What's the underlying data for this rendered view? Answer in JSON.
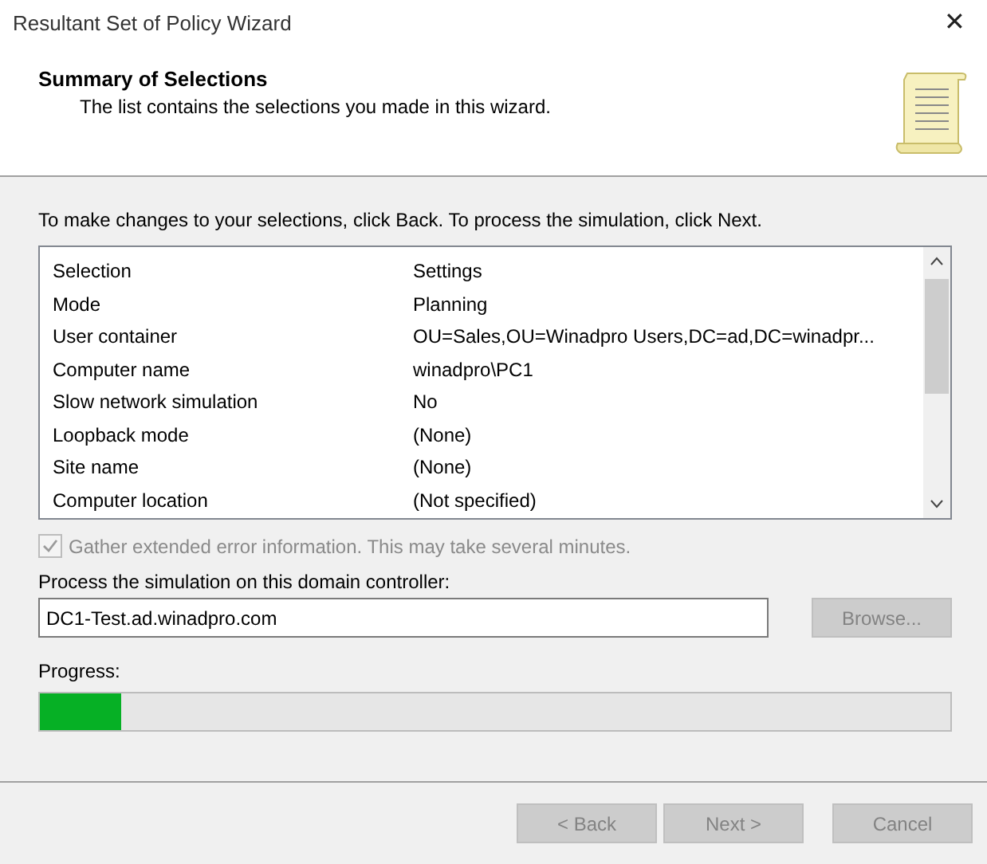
{
  "window": {
    "title": "Resultant Set of Policy Wizard",
    "close": "✕"
  },
  "header": {
    "title": "Summary of Selections",
    "subtitle": "The list contains the selections you made in this wizard."
  },
  "instruction": "To make changes to your selections, click Back. To process the simulation, click Next.",
  "table": {
    "columns": [
      "Selection",
      "Settings"
    ],
    "rows": [
      [
        "Mode",
        "Planning"
      ],
      [
        "User container",
        "OU=Sales,OU=Winadpro Users,DC=ad,DC=winadpr..."
      ],
      [
        "Computer name",
        "winadpro\\PC1"
      ],
      [
        "Slow network simulation",
        "No"
      ],
      [
        "Loopback mode",
        "(None)"
      ],
      [
        "Site name",
        "(None)"
      ],
      [
        "Computer location",
        "(Not specified)"
      ]
    ]
  },
  "gather": {
    "label": "Gather extended error information. This may take several minutes.",
    "checked": true,
    "disabled": true
  },
  "domain_controller": {
    "label": "Process the simulation on this domain controller:",
    "value": "DC1-Test.ad.winadpro.com",
    "browse": {
      "label": "Browse...",
      "disabled": true
    }
  },
  "progress": {
    "label": "Progress:",
    "level": 0.09
  },
  "buttons": [
    {
      "label": "< Back",
      "disabled": true
    },
    {
      "label": "Next >",
      "disabled": true
    },
    {
      "label": "Cancel",
      "disabled": true
    }
  ]
}
